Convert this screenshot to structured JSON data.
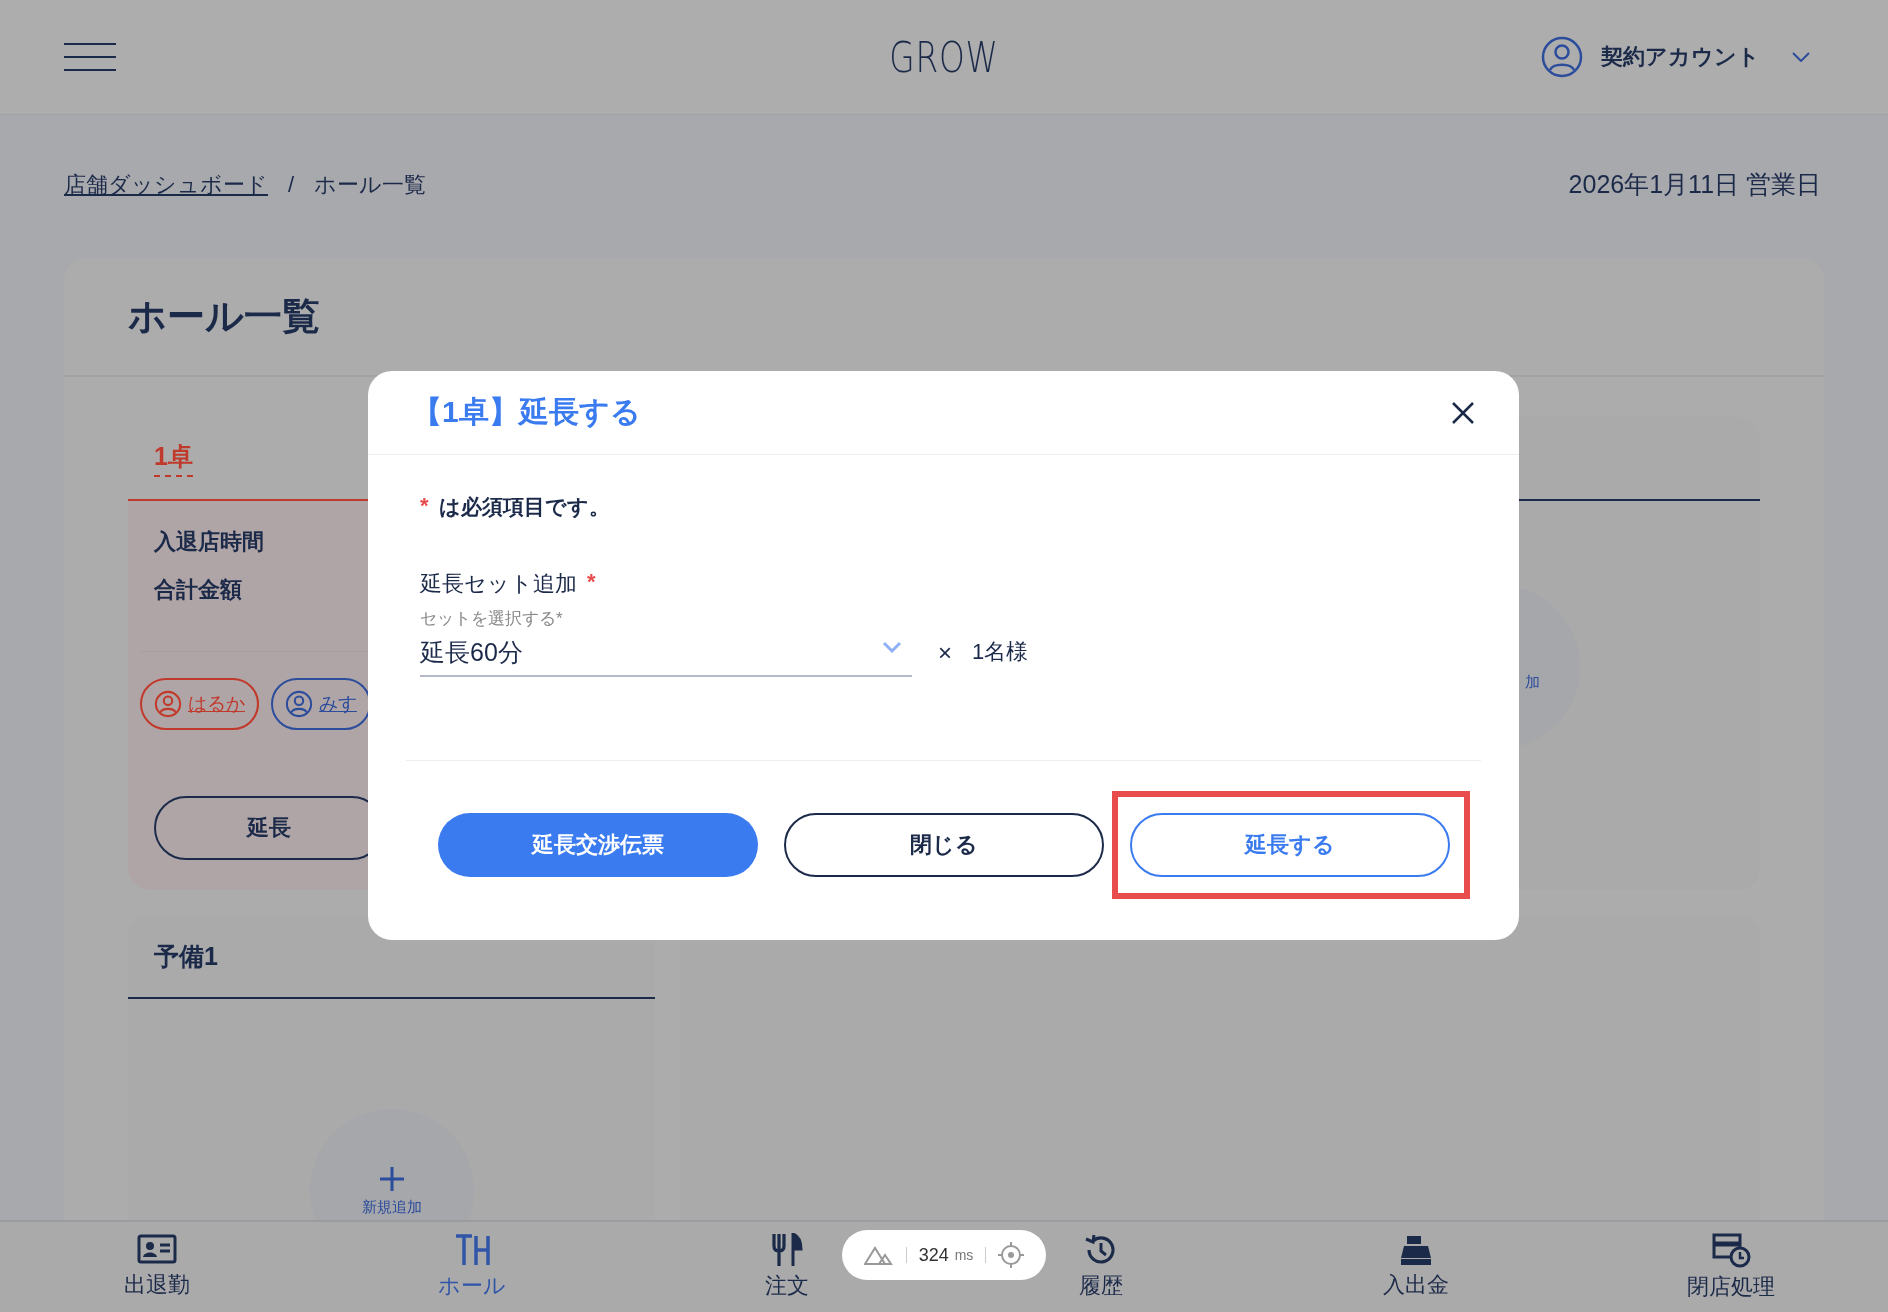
{
  "header": {
    "logo": "GROW",
    "account": "契約アカウント"
  },
  "breadcrumb": {
    "items": [
      {
        "label": "店舗ダッシュボード",
        "link": true
      },
      {
        "label": "ホール一覧",
        "link": false
      }
    ],
    "separator": "/"
  },
  "business_date": "2026年1月11日 営業日",
  "page_title": "ホール一覧",
  "tables": [
    {
      "name": "1卓",
      "occupied": true,
      "fields": [
        "入退店時間",
        "合計金額"
      ],
      "staff": [
        {
          "name": "はるか",
          "color": "#c0392b"
        },
        {
          "name": "みす",
          "color": "#2c4c9c"
        }
      ],
      "action": "延長"
    },
    {
      "name": "予備1",
      "occupied": false,
      "add_label": "新規追加"
    }
  ],
  "hidden_card": {
    "add_label": "加"
  },
  "modal": {
    "title": "【1卓】延長する",
    "note": {
      "mark": "*",
      "text": "は必須項目です。"
    },
    "field": {
      "label": "延長セット追加",
      "required_mark": "*"
    },
    "select": {
      "label": "セットを選択する*",
      "value": "延長60分"
    },
    "multiplier": "×",
    "quantity": "1名様",
    "buttons": [
      {
        "label": "延長交渉伝票",
        "kind": "primary",
        "highlighted": false
      },
      {
        "label": "閉じる",
        "kind": "secondary",
        "highlighted": false
      },
      {
        "label": "延長する",
        "kind": "outline",
        "highlighted": true
      }
    ]
  },
  "nav": [
    {
      "label": "出退勤",
      "kind": "attendance",
      "selected": false
    },
    {
      "label": "ホール",
      "kind": "hall",
      "selected": true
    },
    {
      "label": "注文",
      "kind": "order",
      "selected": false
    },
    {
      "label": "履歴",
      "kind": "history",
      "selected": false
    },
    {
      "label": "入出金",
      "kind": "cash",
      "selected": false
    },
    {
      "label": "閉店処理",
      "kind": "closing",
      "selected": false
    }
  ],
  "perf": {
    "value": "324",
    "unit": "ms"
  }
}
